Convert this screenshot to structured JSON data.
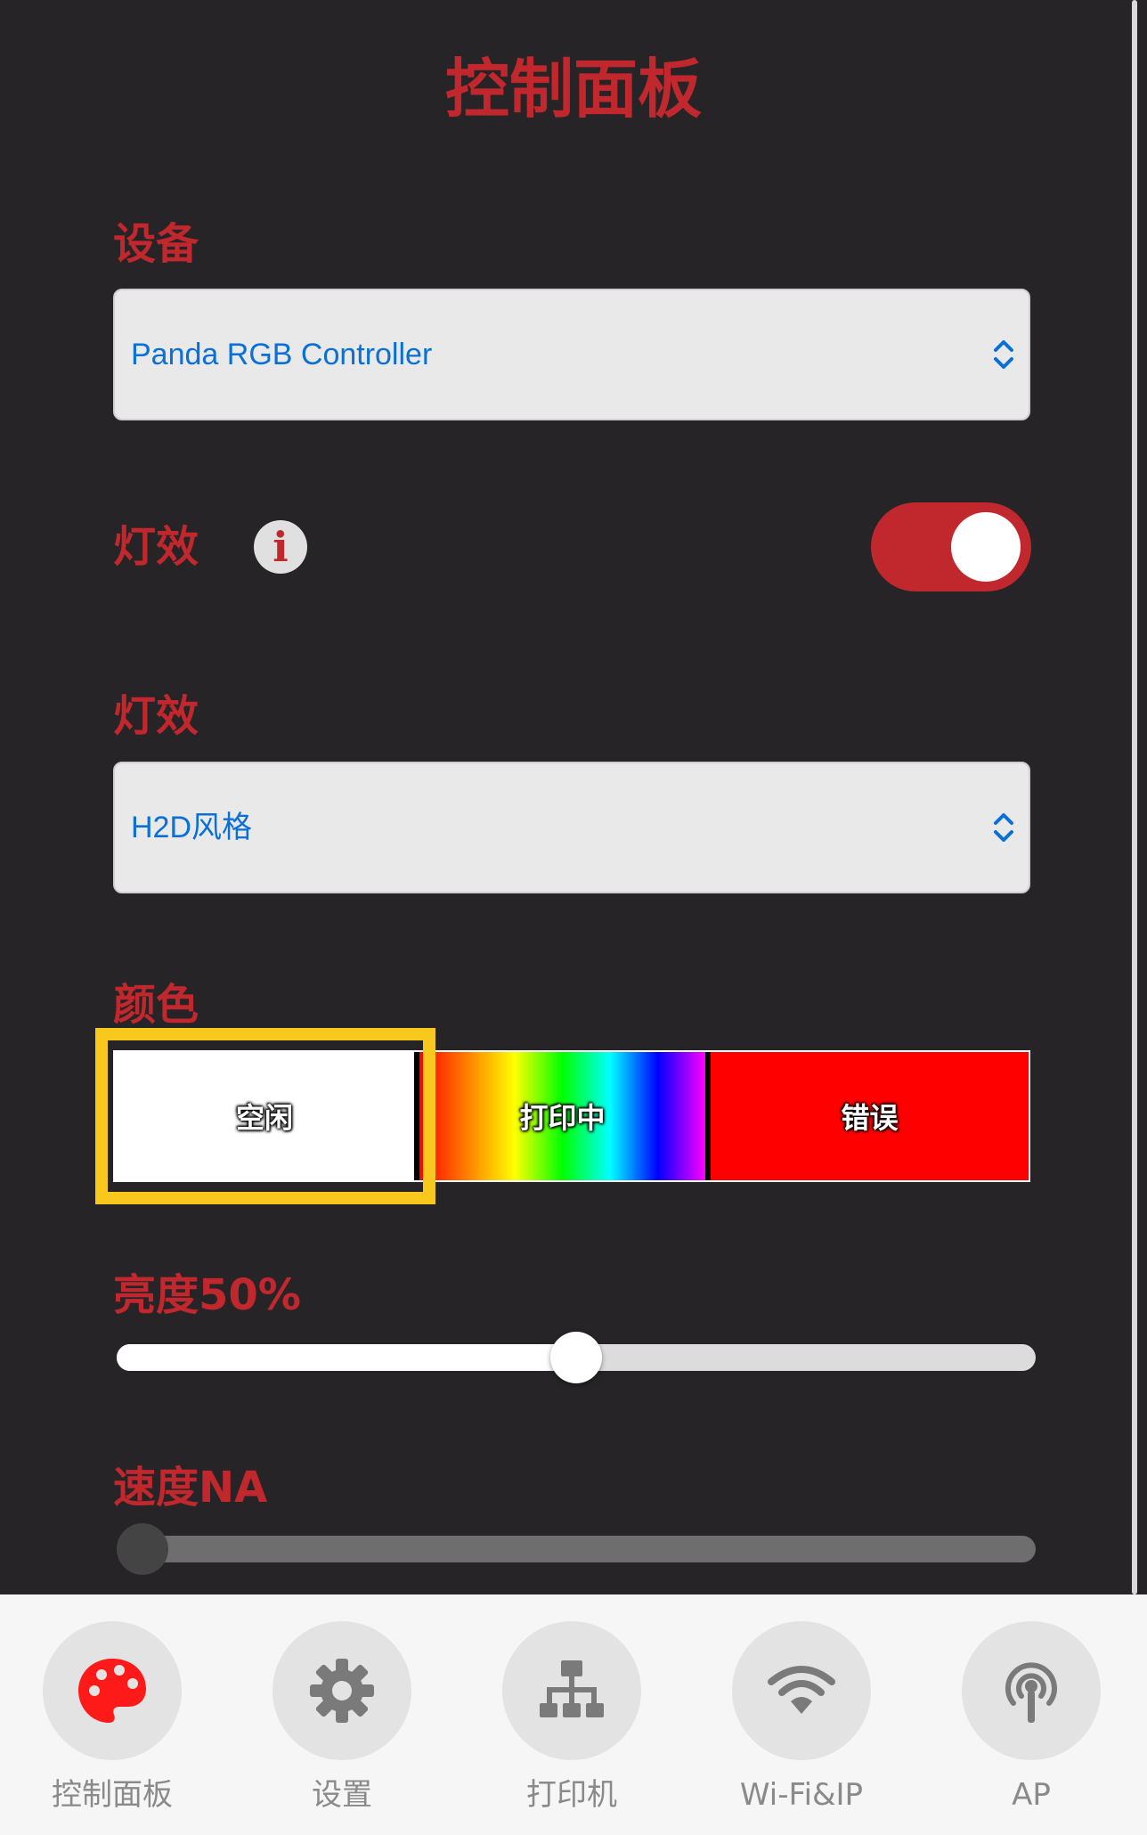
{
  "page": {
    "title": "控制面板"
  },
  "device": {
    "label": "设备",
    "value": "Panda RGB Controller"
  },
  "effect_toggle": {
    "label": "灯效",
    "info": "i",
    "enabled": true
  },
  "effect": {
    "label": "灯效",
    "value": "H2D风格"
  },
  "color": {
    "label": "颜色",
    "segments": [
      {
        "label": "空闲",
        "color": "#ffffff",
        "selected": true
      },
      {
        "label": "打印中",
        "color": "rainbow"
      },
      {
        "label": "错误",
        "color": "#ff0000"
      }
    ]
  },
  "brightness": {
    "label": "亮度50%",
    "value": 0.5
  },
  "speed": {
    "label": "速度NA",
    "value": 0
  },
  "tabs": [
    {
      "label": "控制面板",
      "icon": "palette-icon",
      "active": true
    },
    {
      "label": "设置",
      "icon": "gear-icon"
    },
    {
      "label": "打印机",
      "icon": "network-icon"
    },
    {
      "label": "Wi-Fi&IP",
      "icon": "wifi-icon"
    },
    {
      "label": "AP",
      "icon": "antenna-icon"
    }
  ],
  "colors": {
    "accent": "#c0282d",
    "highlight": "#f9c81d",
    "background": "#262426"
  }
}
